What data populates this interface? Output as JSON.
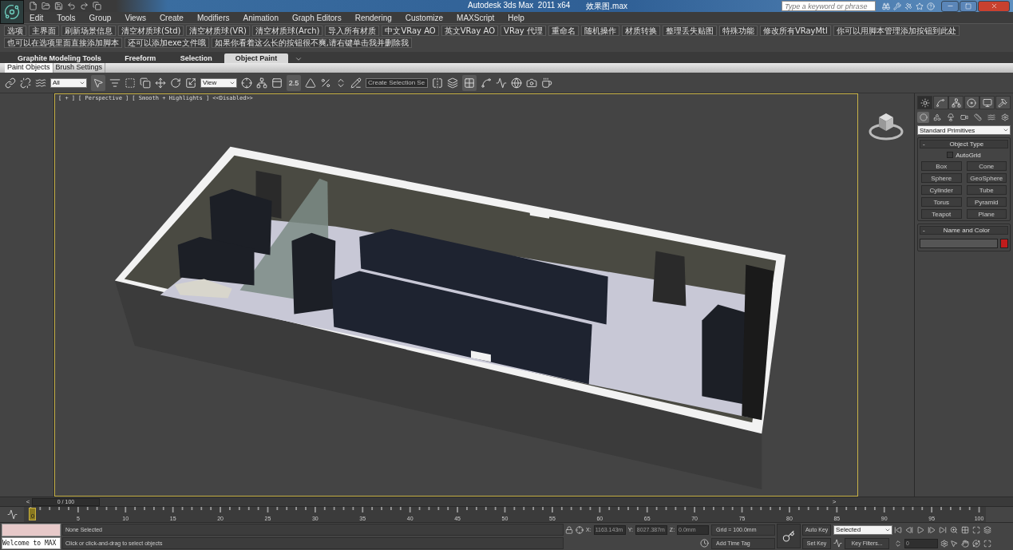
{
  "title_bar": {
    "app": "Autodesk 3ds Max  2011 x64",
    "file": "效果图.max",
    "search": {
      "placeholder": "Type a keyword or phrase"
    }
  },
  "menu": [
    "Edit",
    "Tools",
    "Group",
    "Views",
    "Create",
    "Modifiers",
    "Animation",
    "Graph Editors",
    "Rendering",
    "Customize",
    "MAXScript",
    "Help"
  ],
  "custom_toolbar": [
    "选项",
    "主界面",
    "刷新场景信息",
    "清空材质球(Std)",
    "清空材质球(VR)",
    "清空材质球(Arch)",
    "导入所有材质",
    "中文VRay AO",
    "英文VRay AO",
    "VRay 代理",
    "重命名",
    "随机操作",
    "材质转换",
    "整理丢失贴图",
    "特殊功能",
    "修改所有VRayMtl",
    "你可以用脚本管理添加按钮到此处",
    "也可以在选项里面直接添加脚本",
    "还可以添加exe文件哦",
    "如果你看着这么长的按钮很不爽,请右键单击我并删除我"
  ],
  "ribbon": {
    "tabs": [
      {
        "label": "Graphite Modeling Tools",
        "selected": false
      },
      {
        "label": "Freeform",
        "selected": false
      },
      {
        "label": "Selection",
        "selected": false
      },
      {
        "label": "Object Paint",
        "selected": true
      }
    ],
    "subtabs": [
      {
        "label": "Paint Objects",
        "selected": true
      },
      {
        "label": "Brush Settings",
        "selected": false
      }
    ]
  },
  "main_toolbar": {
    "selection_filter": "All",
    "reference_coordinate": "View",
    "snap_toggle": "2.5",
    "named_selection": "Create Selection Se"
  },
  "viewport": {
    "labels": [
      "[ + ]",
      "[ Perspective ]",
      "[ Smooth + Highlights ]",
      "<<Disabled>>"
    ]
  },
  "command_panel": {
    "tabs": [
      {
        "selected": true
      },
      {
        "selected": false
      },
      {
        "selected": false
      },
      {
        "selected": false
      },
      {
        "selected": false
      },
      {
        "selected": false
      }
    ],
    "categories": [
      {
        "selected": true
      },
      {
        "selected": false
      },
      {
        "selected": false
      },
      {
        "selected": false
      },
      {
        "selected": false
      },
      {
        "selected": false
      },
      {
        "selected": false
      }
    ],
    "dropdown": "Standard Primitives",
    "object_type": {
      "title": "Object Type",
      "collapse": "-",
      "autogrid": {
        "label": "AutoGrid",
        "checked": false
      },
      "buttons": [
        "Box",
        "Cone",
        "Sphere",
        "GeoSphere",
        "Cylinder",
        "Tube",
        "Torus",
        "Pyramid",
        "Teapot",
        "Plane"
      ]
    },
    "name_and_color": {
      "title": "Name and Color",
      "collapse": "-",
      "color": "#c01c1c"
    }
  },
  "time_slider": {
    "label": "0 / 100",
    "prev": "<",
    "next": ">",
    "level": 0
  },
  "timeline": {
    "marker": "0",
    "labels": [
      "5",
      "10",
      "15",
      "20",
      "25",
      "30",
      "35",
      "40",
      "45",
      "50",
      "55",
      "60",
      "65",
      "70",
      "75",
      "80",
      "85",
      "90",
      "95",
      "100"
    ]
  },
  "listener": {
    "output": "Welcome to MAX"
  },
  "prompt": {
    "status": "None Selected",
    "hint": "Click or click-and-drag to select objects"
  },
  "coordinates": [
    {
      "axis": "X:",
      "value": "1163.143m"
    },
    {
      "axis": "Y:",
      "value": "8027.387m"
    },
    {
      "axis": "Z:",
      "value": "0.0mm"
    }
  ],
  "grid": "Grid = 100.0mm",
  "time_tag": "Add Time Tag",
  "animation": {
    "auto_key": "Auto Key",
    "set_key": "Set Key",
    "key_mode": "Selected",
    "key_filters": "Key Filters...",
    "frame": "0"
  }
}
